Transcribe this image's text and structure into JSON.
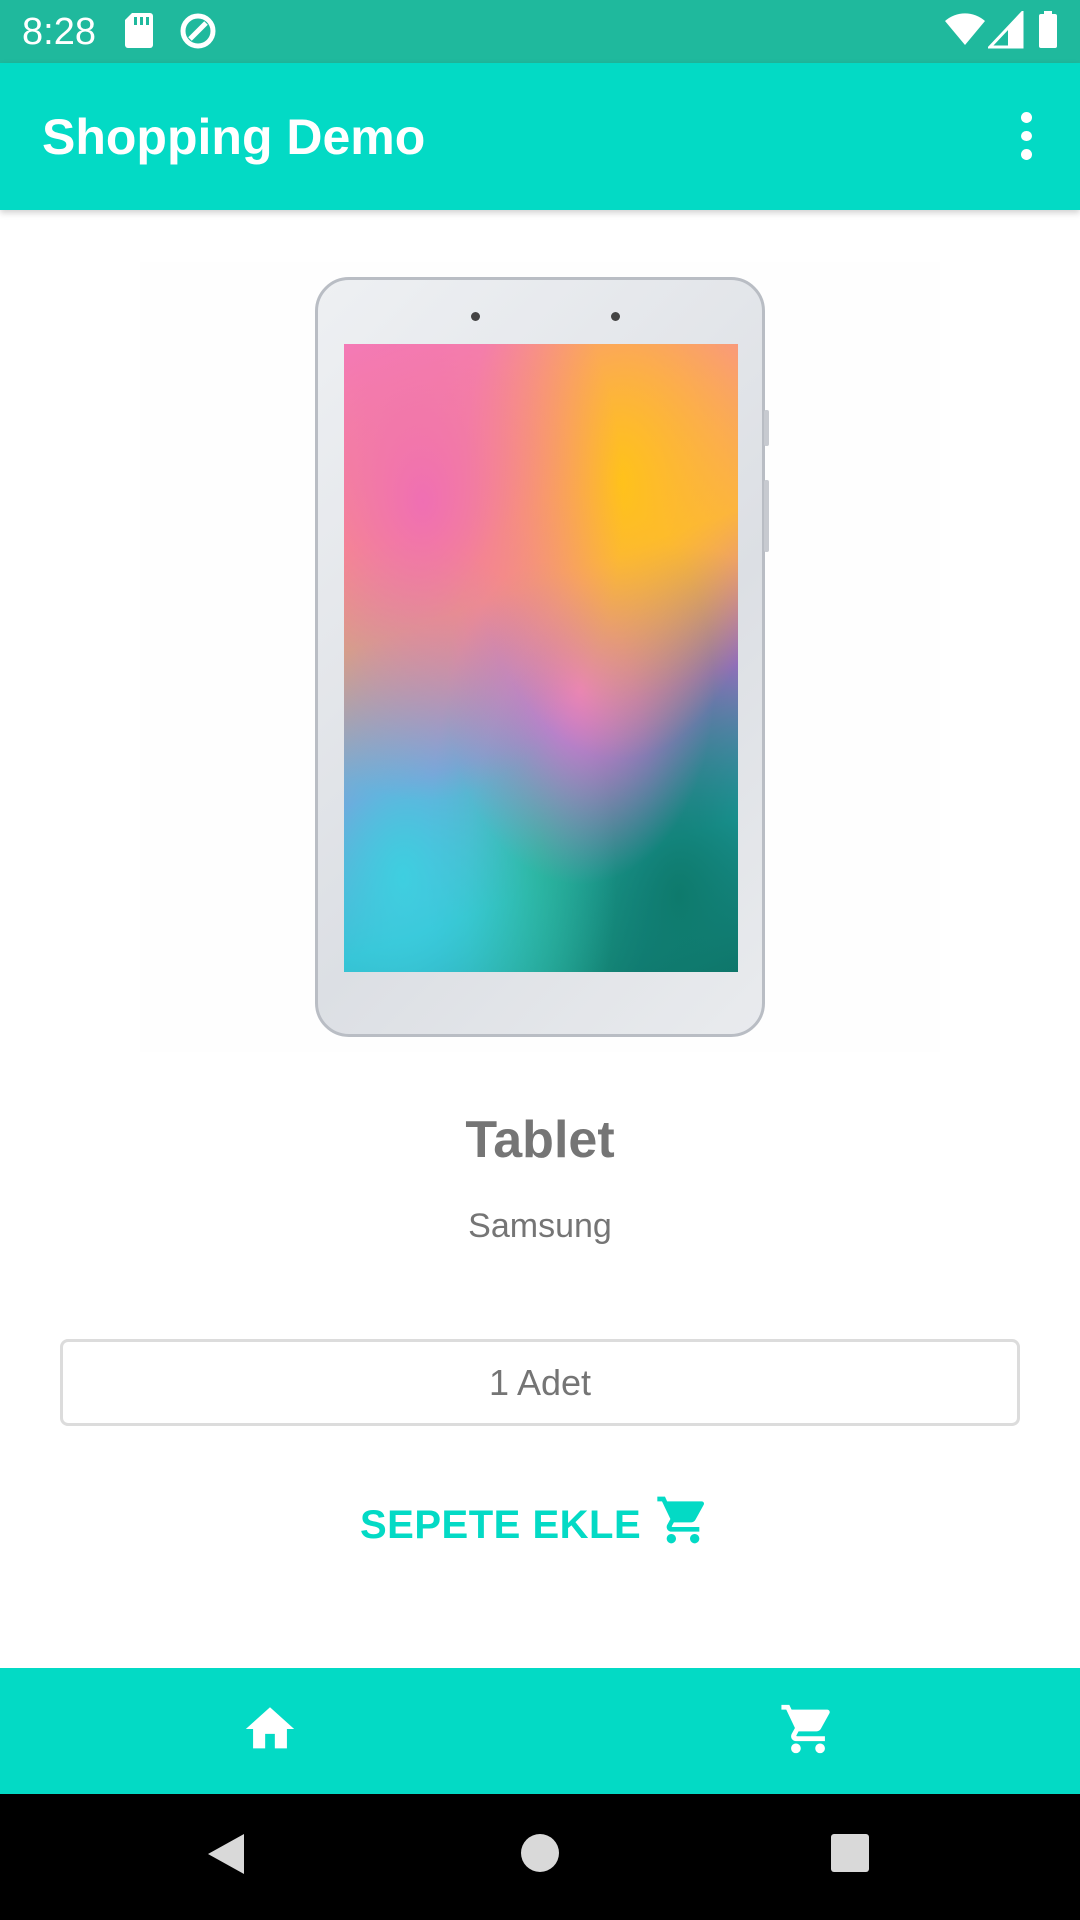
{
  "status_bar": {
    "time": "8:28",
    "icons": [
      "sd-card-icon",
      "data-saver-icon",
      "wifi-icon",
      "signal-icon",
      "battery-icon"
    ]
  },
  "app_bar": {
    "title": "Shopping Demo",
    "menu_icon": "overflow-menu-icon"
  },
  "product": {
    "name": "Tablet",
    "brand": "Samsung",
    "quantity_label": "1 Adet",
    "add_to_cart_label": "SEPETE EKLE",
    "add_to_cart_icon": "cart-icon"
  },
  "bottom_nav": {
    "items": [
      {
        "icon": "home-icon"
      },
      {
        "icon": "cart-icon"
      }
    ]
  },
  "system_nav": {
    "buttons": [
      "back-icon",
      "home-circle-icon",
      "recents-icon"
    ]
  },
  "colors": {
    "accent": "#03dac5",
    "status_bar": "#1fb99d",
    "text_secondary": "#757575"
  }
}
